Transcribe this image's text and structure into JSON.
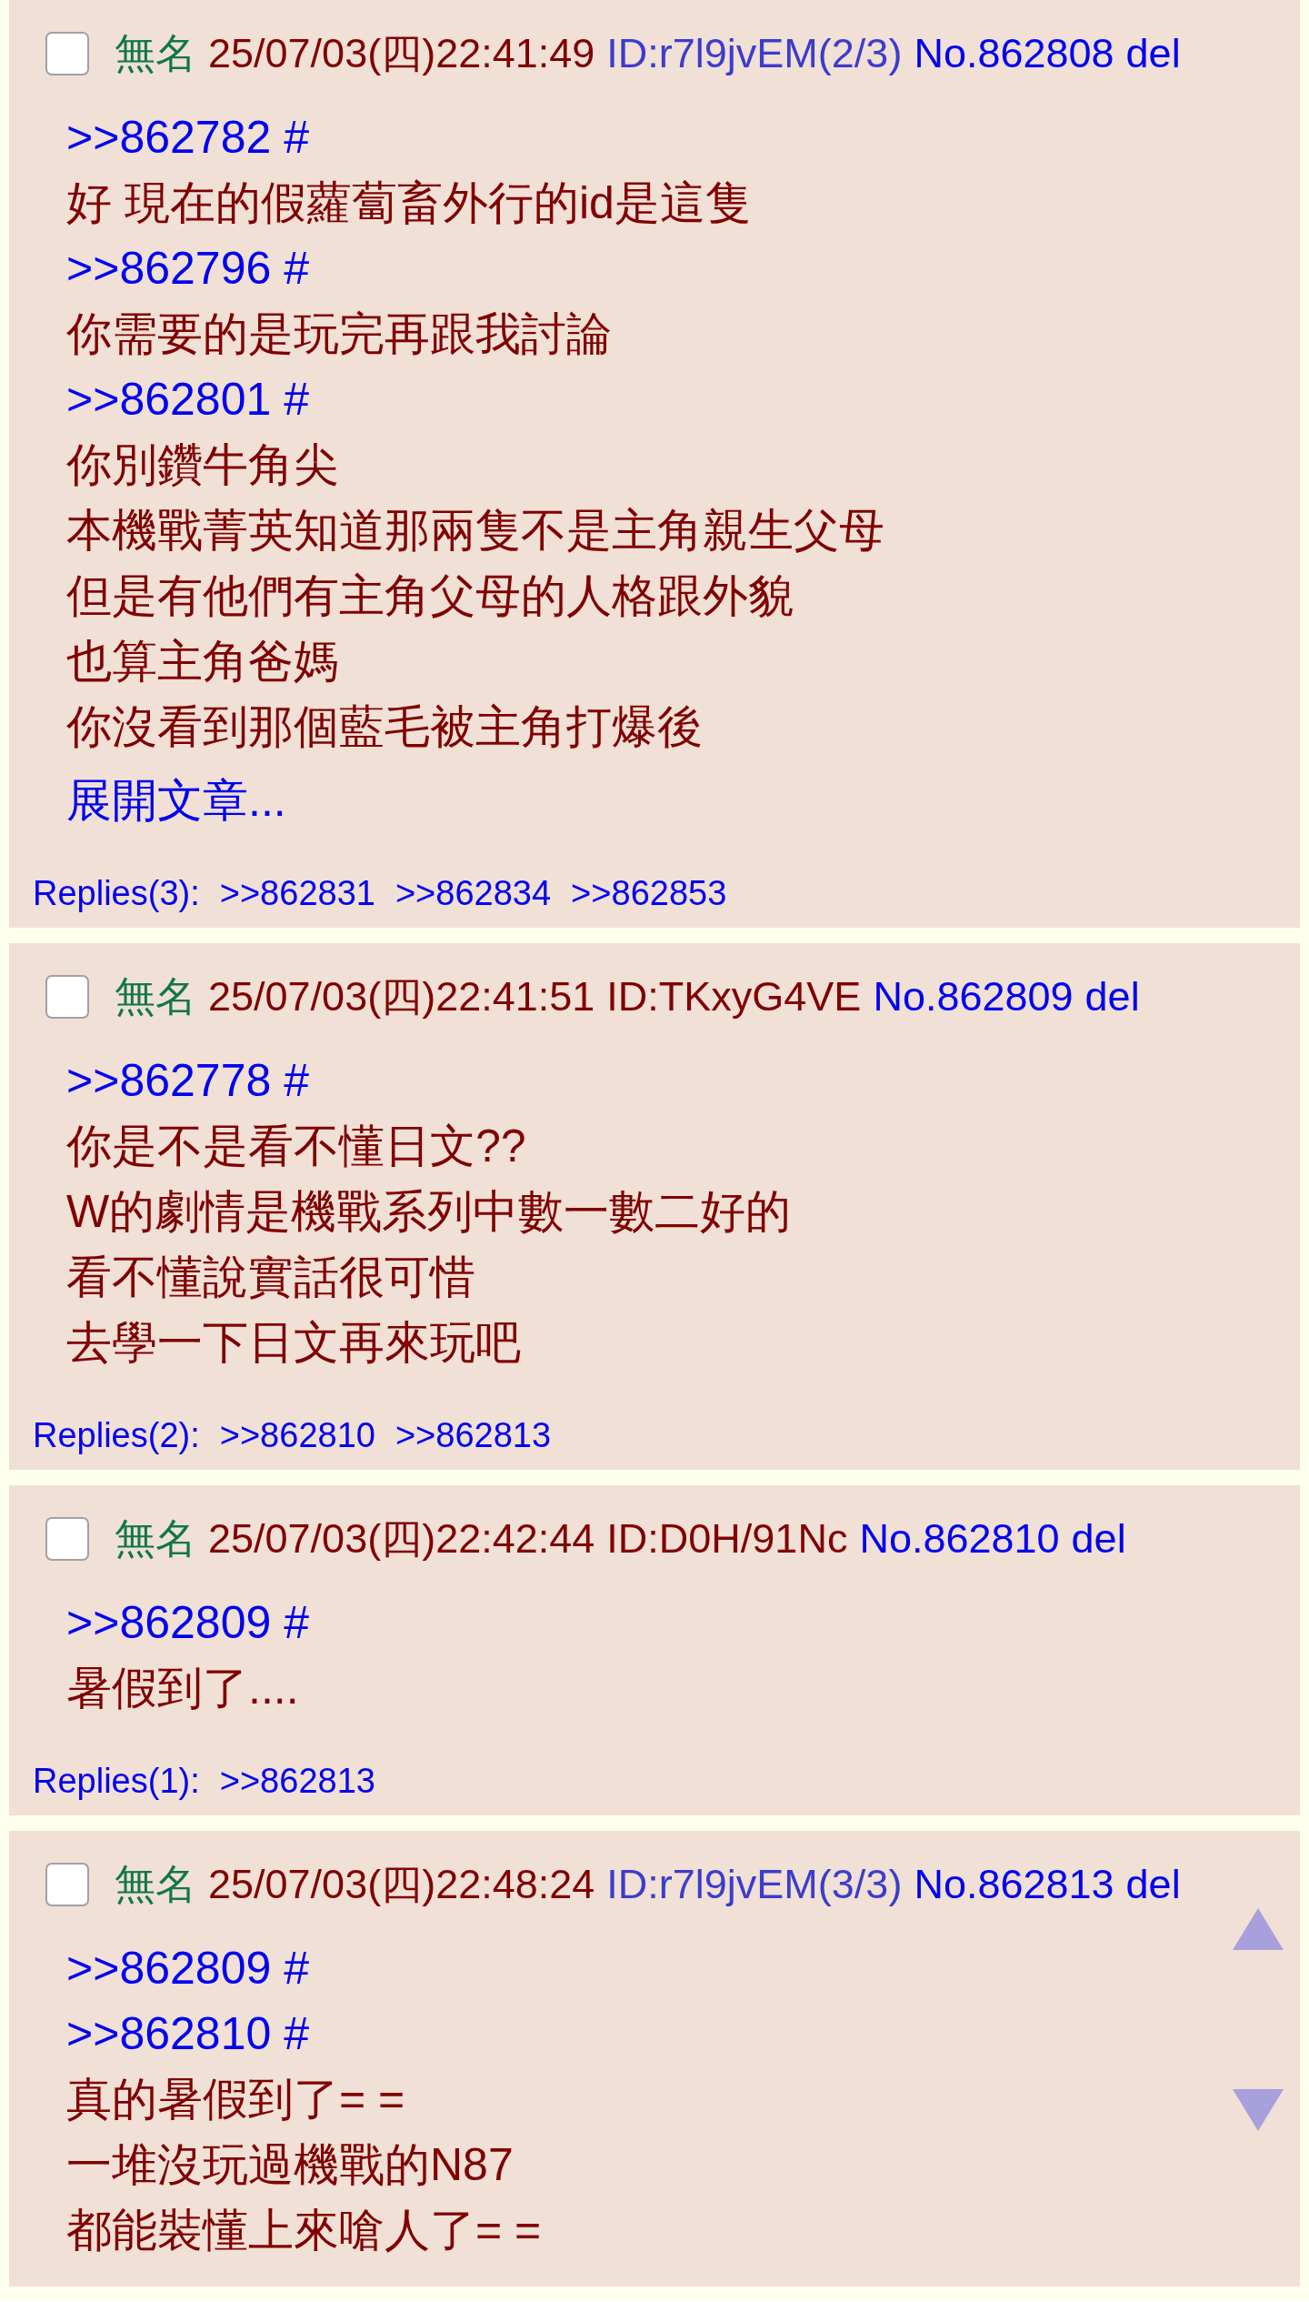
{
  "posts": [
    {
      "checked": false,
      "name": "無名",
      "datetime": "25/07/03(四)22:41:49",
      "id": {
        "text": "ID:r7l9jvEM(2/3)",
        "color": "#3c3ccc"
      },
      "number": "No.862808",
      "delete": "del",
      "lines": [
        {
          "kind": "quote",
          "text": ">>862782 #"
        },
        {
          "kind": "text",
          "text": "好 現在的假蘿蔔畜外行的id是這隻"
        },
        {
          "kind": "quote",
          "text": ">>862796 #"
        },
        {
          "kind": "text",
          "text": "你需要的是玩完再跟我討論"
        },
        {
          "kind": "quote",
          "text": ">>862801 #"
        },
        {
          "kind": "text",
          "text": "你別鑽牛角尖"
        },
        {
          "kind": "text",
          "text": "本機戰菁英知道那兩隻不是主角親生父母"
        },
        {
          "kind": "text",
          "text": "但是有他們有主角父母的人格跟外貌"
        },
        {
          "kind": "text",
          "text": "也算主角爸媽"
        },
        {
          "kind": "text",
          "text": "你沒看到那個藍毛被主角打爆後"
        },
        {
          "kind": "expand",
          "text": "展開文章..."
        }
      ],
      "replies": {
        "label": "Replies(3):",
        "links": [
          ">>862831",
          ">>862834",
          ">>862853"
        ]
      }
    },
    {
      "checked": false,
      "name": "無名",
      "datetime": "25/07/03(四)22:41:51",
      "id": {
        "text": "ID:TKxyG4VE",
        "color": "#800000"
      },
      "number": "No.862809",
      "delete": "del",
      "lines": [
        {
          "kind": "quote",
          "text": ">>862778 #"
        },
        {
          "kind": "text",
          "text": "你是不是看不懂日文??"
        },
        {
          "kind": "text",
          "text": "W的劇情是機戰系列中數一數二好的"
        },
        {
          "kind": "text",
          "text": "看不懂說實話很可惜"
        },
        {
          "kind": "text",
          "text": "去學一下日文再來玩吧"
        }
      ],
      "replies": {
        "label": "Replies(2):",
        "links": [
          ">>862810",
          ">>862813"
        ]
      }
    },
    {
      "checked": false,
      "name": "無名",
      "datetime": "25/07/03(四)22:42:44",
      "id": {
        "text": "ID:D0H/91Nc",
        "color": "#800000"
      },
      "number": "No.862810",
      "delete": "del",
      "lines": [
        {
          "kind": "quote",
          "text": ">>862809 #"
        },
        {
          "kind": "text",
          "text": "暑假到了...."
        }
      ],
      "replies": {
        "label": "Replies(1):",
        "links": [
          ">>862813"
        ]
      }
    },
    {
      "checked": false,
      "name": "無名",
      "datetime": "25/07/03(四)22:48:24",
      "id": {
        "text": "ID:r7l9jvEM(3/3)",
        "color": "#3c3ccc"
      },
      "number": "No.862813",
      "delete": "del",
      "lines": [
        {
          "kind": "quote",
          "text": ">>862809 #"
        },
        {
          "kind": "quote",
          "text": ">>862810 #"
        },
        {
          "kind": "text",
          "text": "真的暑假到了= ="
        },
        {
          "kind": "text",
          "text": "一堆沒玩過機戰的N87"
        },
        {
          "kind": "text",
          "text": "都能裝懂上來嗆人了= ="
        }
      ]
    }
  ]
}
